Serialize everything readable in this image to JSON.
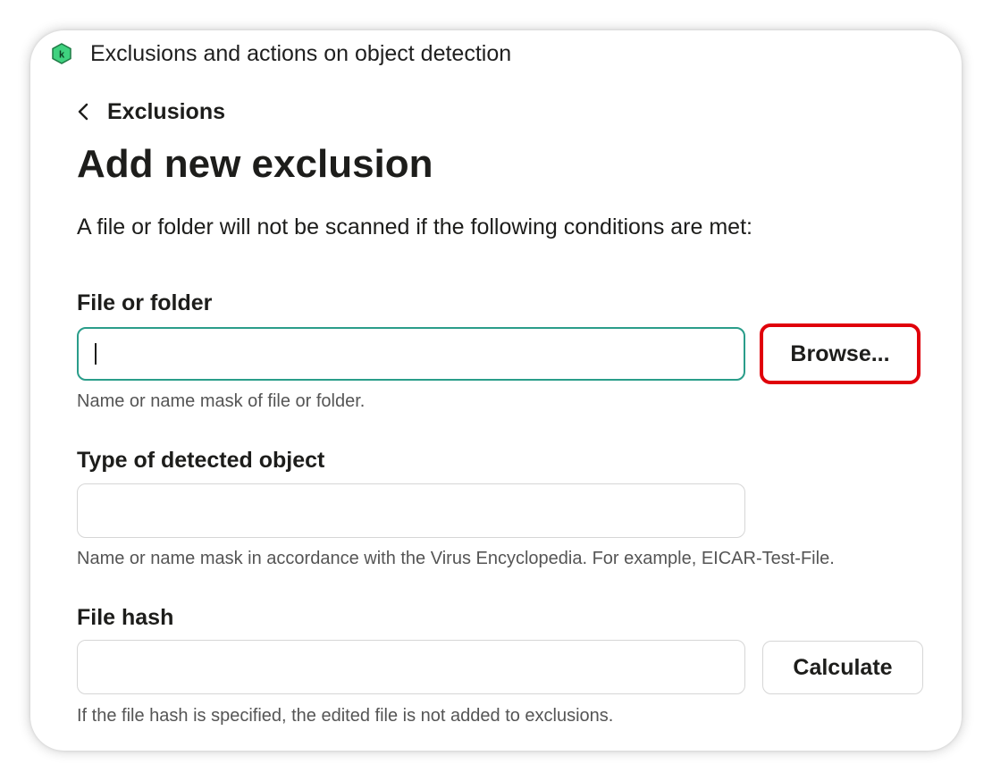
{
  "window": {
    "title": "Exclusions and actions on object detection",
    "logo_icon": "kaspersky-logo-icon",
    "logo_letter": "k"
  },
  "nav": {
    "back_icon": "chevron-left-icon",
    "back_label": "Exclusions"
  },
  "page": {
    "title": "Add new exclusion",
    "description": "A file or folder will not be scanned if the following conditions are met:"
  },
  "fields": {
    "file_or_folder": {
      "label": "File or folder",
      "value": "",
      "hint": "Name or name mask of file or folder.",
      "button_label": "Browse..."
    },
    "detected_object_type": {
      "label": "Type of detected object",
      "value": "",
      "hint": "Name or name mask in accordance with the Virus Encyclopedia. For example, EICAR-Test-File."
    },
    "file_hash": {
      "label": "File hash",
      "value": "",
      "hint": "If the file hash is specified, the edited file is not added to exclusions.",
      "button_label": "Calculate"
    }
  },
  "colors": {
    "accent_focus": "#2a9d8a",
    "highlight": "#e0000a",
    "logo_green": "#3fd27f"
  }
}
